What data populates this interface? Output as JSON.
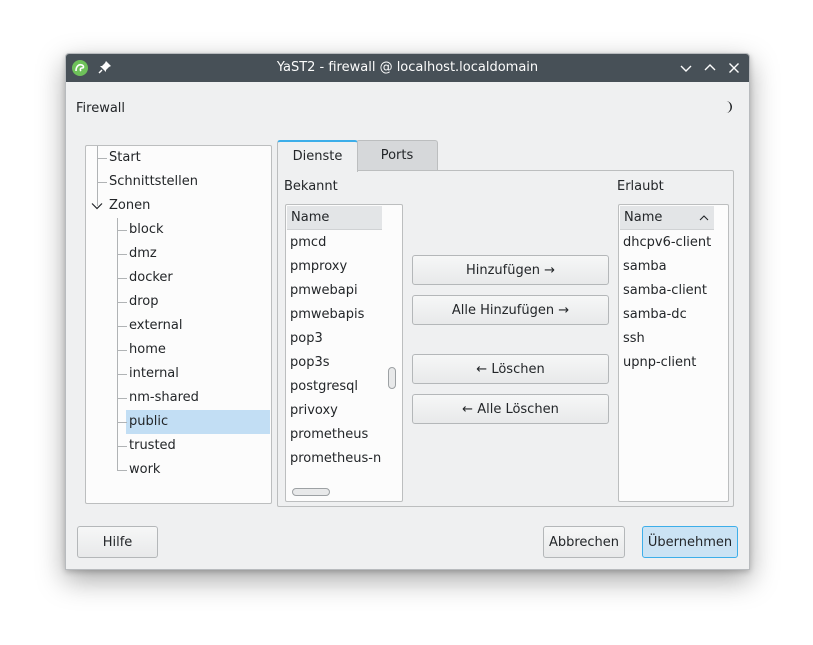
{
  "window": {
    "title": "YaST2 - firewall @ localhost.localdomain"
  },
  "header": {
    "label": "Firewall"
  },
  "tree": {
    "items": [
      {
        "label": "Start"
      },
      {
        "label": "Schnittstellen"
      },
      {
        "label": "Zonen"
      }
    ],
    "zones": [
      "block",
      "dmz",
      "docker",
      "drop",
      "external",
      "home",
      "internal",
      "nm-shared",
      "public",
      "trusted",
      "work"
    ],
    "selected": "public"
  },
  "tabs": [
    {
      "label": "Dienste"
    },
    {
      "label": "Ports"
    }
  ],
  "known": {
    "label": "Bekannt",
    "column": "Name",
    "items": [
      "pmcd",
      "pmproxy",
      "pmwebapi",
      "pmwebapis",
      "pop3",
      "pop3s",
      "postgresql",
      "privoxy",
      "prometheus",
      "prometheus-nc"
    ]
  },
  "allowed": {
    "label": "Erlaubt",
    "column": "Name",
    "items": [
      "dhcpv6-client",
      "samba",
      "samba-client",
      "samba-dc",
      "ssh",
      "upnp-client"
    ]
  },
  "actions": {
    "add": "Hinzufügen →",
    "add_all": "Alle Hinzufügen →",
    "remove": "← Löschen",
    "remove_all": "← Alle Löschen"
  },
  "footer": {
    "help": "Hilfe",
    "cancel": "Abbrechen",
    "apply": "Übernehmen"
  },
  "colors": {
    "titlebar": "#475057",
    "accent": "#3daee9",
    "selection": "#c2def4"
  }
}
